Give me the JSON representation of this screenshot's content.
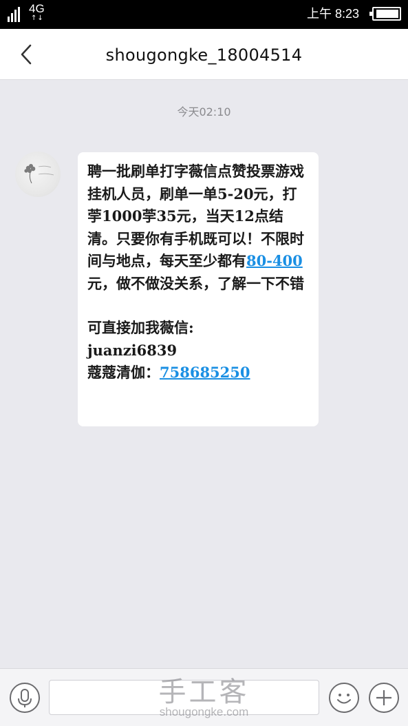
{
  "status_bar": {
    "network": "4G",
    "network_arrows": "↑↓",
    "time": "上午 8:23",
    "battery_level_fraction": 0.95
  },
  "header": {
    "title": "shougongke_18004514"
  },
  "conversation": {
    "timestamp": "今天02:10",
    "message": {
      "line_part1": "聘一批刷单打字薇信点赞投票游戏挂机人员，刷单一单5-20元，打荢1000荢35元，当天12点结清。只要你有手机既可以！不限时间与地点，每天至少都有",
      "amount_link": "80-400",
      "line_part2": "元，做不做没关系，了解一下不错",
      "contact_intro": "可直接加我薇信:",
      "wechat_id": "juanzi6839",
      "qq_label": "蔻蔻清伽：",
      "qq_number": "758685250"
    }
  },
  "input_bar": {
    "mic_icon": "microphone-icon",
    "emoji_icon": "smiley-icon",
    "plus_icon": "plus-icon"
  },
  "watermark": {
    "brand": "手工客",
    "site": "shougongke.com"
  }
}
